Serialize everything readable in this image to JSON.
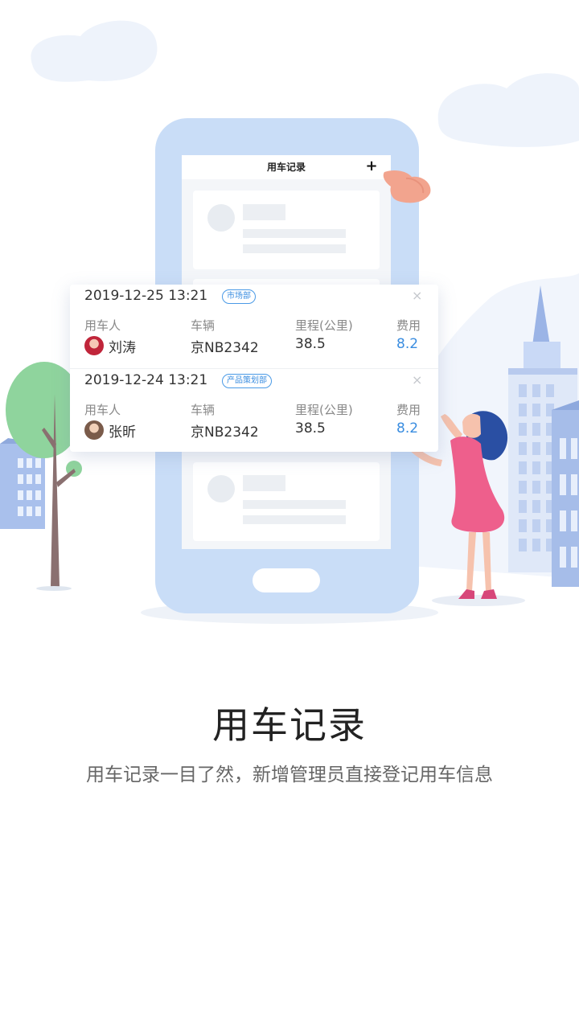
{
  "phone_screen": {
    "title": "用车记录",
    "add_label": "+"
  },
  "records": [
    {
      "datetime": "2019-12-25 13:21",
      "department": "市场部",
      "close_label": "×",
      "labels": {
        "user": "用车人",
        "vehicle": "车辆",
        "mileage": "里程(公里)",
        "fee": "费用"
      },
      "user": "刘涛",
      "vehicle": "京NB2342",
      "mileage": "38.5",
      "fee": "8.2"
    },
    {
      "datetime": "2019-12-24 13:21",
      "department": "产品策划部",
      "close_label": "×",
      "labels": {
        "user": "用车人",
        "vehicle": "车辆",
        "mileage": "里程(公里)",
        "fee": "费用"
      },
      "user": "张昕",
      "vehicle": "京NB2342",
      "mileage": "38.5",
      "fee": "8.2"
    }
  ],
  "feature": {
    "title": "用车记录",
    "subtitle": "用车记录一目了然，新增管理员直接登记用车信息"
  },
  "colors": {
    "accent": "#3a8de0",
    "phone_body": "#c9ddf7",
    "tree": "#8fd49d",
    "dress": "#ef5f8a"
  }
}
